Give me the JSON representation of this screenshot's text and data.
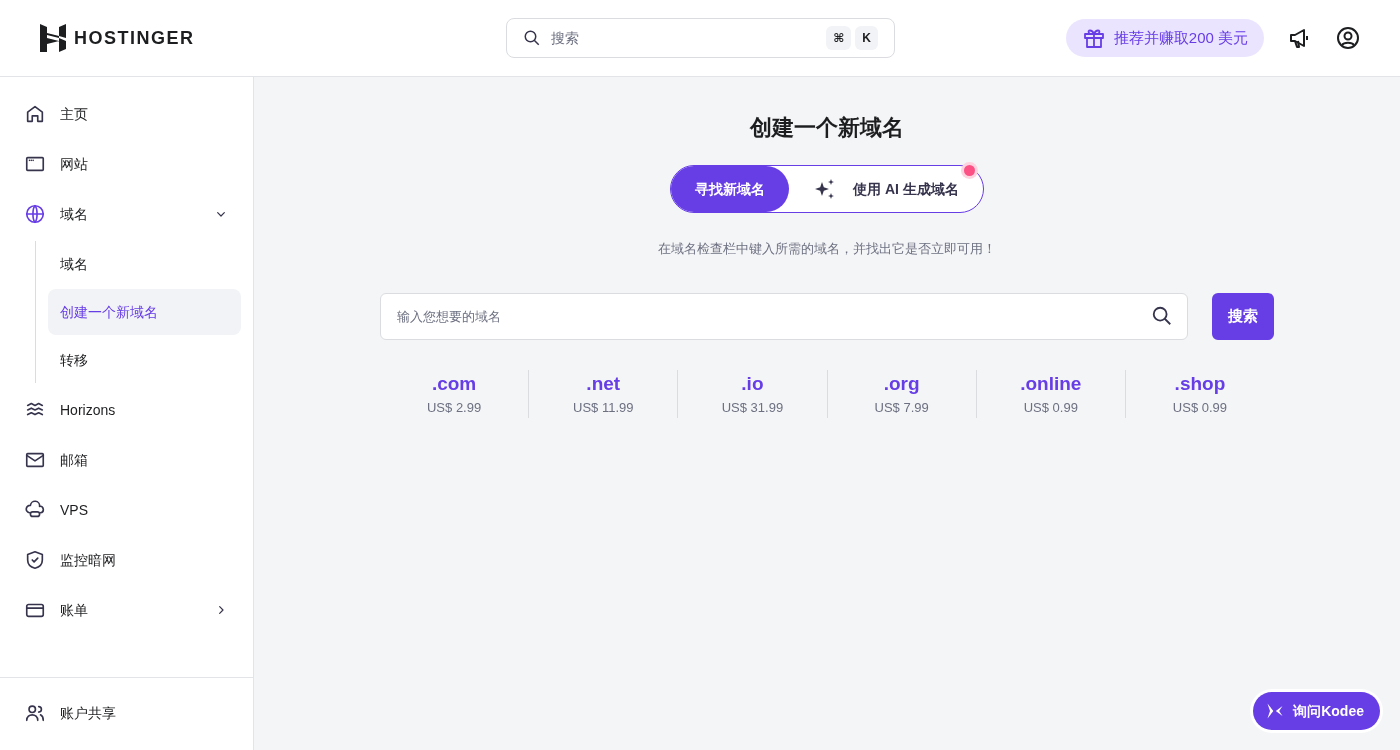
{
  "header": {
    "logo_text": "HOSTINGER",
    "search": {
      "placeholder": "搜索",
      "shortcut_keys": [
        "⌘",
        "K"
      ]
    },
    "referral_button": "推荐并赚取200 美元"
  },
  "sidebar": {
    "items": [
      {
        "label": "主页",
        "selected": false
      },
      {
        "label": "网站",
        "selected": false
      },
      {
        "label": "域名",
        "selected": true,
        "expanded": true,
        "children": [
          {
            "label": "域名",
            "selected": false
          },
          {
            "label": "创建一个新域名",
            "selected": true
          },
          {
            "label": "转移",
            "selected": false
          }
        ]
      },
      {
        "label": "Horizons",
        "selected": false
      },
      {
        "label": "邮箱",
        "selected": false
      },
      {
        "label": "VPS",
        "selected": false
      },
      {
        "label": "监控暗网",
        "selected": false
      },
      {
        "label": "账单",
        "selected": false,
        "expanded": false
      }
    ],
    "footer_item": {
      "label": "账户共享"
    }
  },
  "main": {
    "title": "创建一个新域名",
    "mode_tabs": [
      {
        "label": "寻找新域名",
        "selected": true,
        "notification_dot": false
      },
      {
        "label": "使用 AI 生成域名",
        "selected": false,
        "notification_dot": true
      }
    ],
    "hint": "在域名检查栏中键入所需的域名，并找出它是否立即可用！",
    "domain_search": {
      "placeholder": "输入您想要的域名"
    },
    "search_button": "搜索",
    "tlds": [
      {
        "name": ".com",
        "price": "US$ 2.99"
      },
      {
        "name": ".net",
        "price": "US$ 11.99"
      },
      {
        "name": ".io",
        "price": "US$ 31.99"
      },
      {
        "name": ".org",
        "price": "US$ 7.99"
      },
      {
        "name": ".online",
        "price": "US$ 0.99"
      },
      {
        "name": ".shop",
        "price": "US$ 0.99"
      }
    ]
  },
  "chat_button": "询问Kodee"
}
